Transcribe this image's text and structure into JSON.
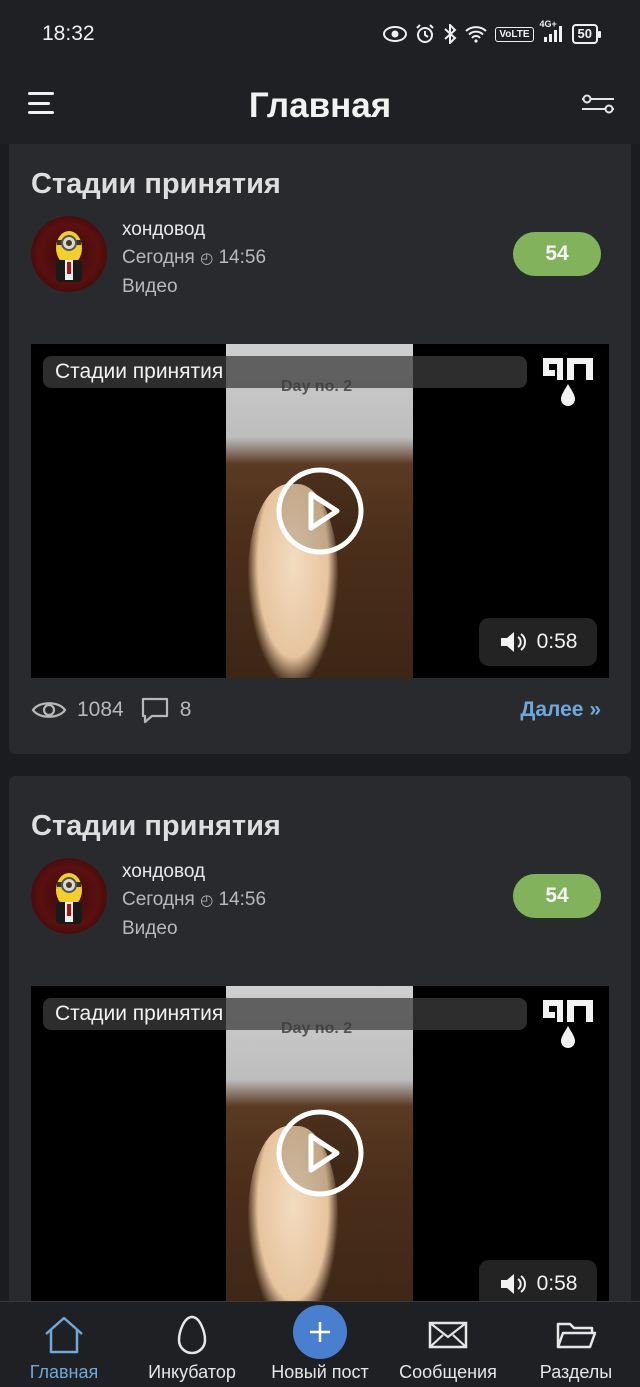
{
  "status_bar": {
    "time": "18:32",
    "volte": "VoLTE",
    "network": "4G+",
    "battery": "50"
  },
  "header": {
    "title": "Главная"
  },
  "posts": [
    {
      "title": "Стадии принятия",
      "author": "хондовод",
      "date": "Сегодня",
      "time": "14:56",
      "category": "Видео",
      "rating": "54",
      "video_title": "Стадии принятия",
      "video_caption": "Day no. 2",
      "duration": "0:58",
      "views": "1084",
      "comments": "8",
      "more": "Далее »"
    },
    {
      "title": "Стадии принятия",
      "author": "хондовод",
      "date": "Сегодня",
      "time": "14:56",
      "category": "Видео",
      "rating": "54",
      "video_title": "Стадии принятия",
      "video_caption": "Day no. 2",
      "duration": "0:58"
    }
  ],
  "bottom_nav": [
    {
      "label": "Главная",
      "icon": "home-icon",
      "active": true
    },
    {
      "label": "Инкубатор",
      "icon": "egg-icon"
    },
    {
      "label": "Новый пост",
      "icon": "plus-icon"
    },
    {
      "label": "Сообщения",
      "icon": "envelope-icon"
    },
    {
      "label": "Разделы",
      "icon": "folder-icon"
    }
  ],
  "colors": {
    "accent": "#6fa8dc",
    "rating": "#82b35c",
    "background": "#1b1c1f",
    "card": "#292a2e"
  }
}
